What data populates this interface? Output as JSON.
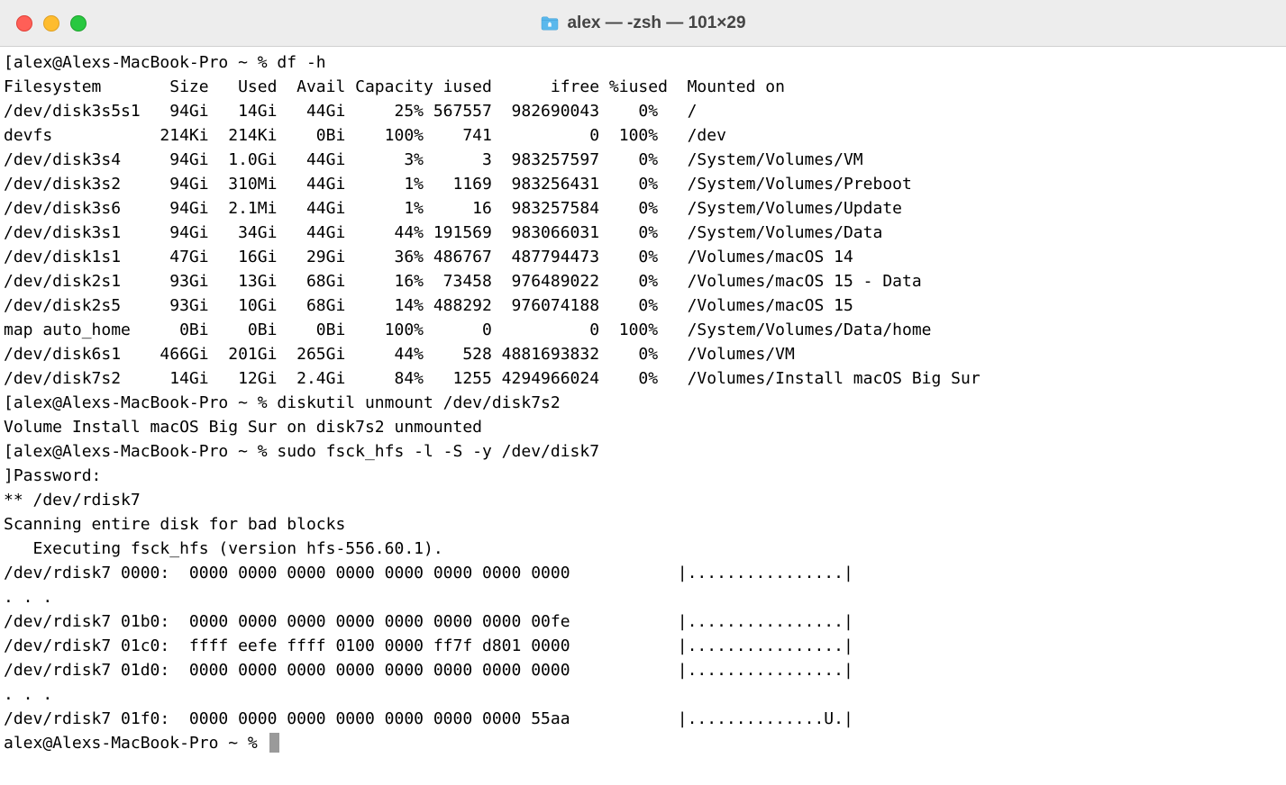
{
  "window": {
    "title": "alex — -zsh — 101×29"
  },
  "prompt_prefix": "[alex@Alexs-MacBook-Pro ~ % ",
  "commands": {
    "cmd1": "df -h",
    "cmd2": "diskutil unmount /dev/disk7s2",
    "cmd3": "sudo fsck_hfs -l -S -y /dev/disk7"
  },
  "df_header": {
    "fs": "Filesystem",
    "size": "Size",
    "used": "Used",
    "avail": "Avail",
    "capacity": "Capacity",
    "iused": "iused",
    "ifree": "ifree",
    "piused": "%iused",
    "mount": "Mounted on"
  },
  "df_rows": [
    {
      "fs": "/dev/disk3s5s1",
      "size": "94Gi",
      "used": "14Gi",
      "avail": "44Gi",
      "capacity": "25%",
      "iused": "567557",
      "ifree": "982690043",
      "piused": "0%",
      "mount": "/"
    },
    {
      "fs": "devfs",
      "size": "214Ki",
      "used": "214Ki",
      "avail": "0Bi",
      "capacity": "100%",
      "iused": "741",
      "ifree": "0",
      "piused": "100%",
      "mount": "/dev"
    },
    {
      "fs": "/dev/disk3s4",
      "size": "94Gi",
      "used": "1.0Gi",
      "avail": "44Gi",
      "capacity": "3%",
      "iused": "3",
      "ifree": "983257597",
      "piused": "0%",
      "mount": "/System/Volumes/VM"
    },
    {
      "fs": "/dev/disk3s2",
      "size": "94Gi",
      "used": "310Mi",
      "avail": "44Gi",
      "capacity": "1%",
      "iused": "1169",
      "ifree": "983256431",
      "piused": "0%",
      "mount": "/System/Volumes/Preboot"
    },
    {
      "fs": "/dev/disk3s6",
      "size": "94Gi",
      "used": "2.1Mi",
      "avail": "44Gi",
      "capacity": "1%",
      "iused": "16",
      "ifree": "983257584",
      "piused": "0%",
      "mount": "/System/Volumes/Update"
    },
    {
      "fs": "/dev/disk3s1",
      "size": "94Gi",
      "used": "34Gi",
      "avail": "44Gi",
      "capacity": "44%",
      "iused": "191569",
      "ifree": "983066031",
      "piused": "0%",
      "mount": "/System/Volumes/Data"
    },
    {
      "fs": "/dev/disk1s1",
      "size": "47Gi",
      "used": "16Gi",
      "avail": "29Gi",
      "capacity": "36%",
      "iused": "486767",
      "ifree": "487794473",
      "piused": "0%",
      "mount": "/Volumes/macOS 14"
    },
    {
      "fs": "/dev/disk2s1",
      "size": "93Gi",
      "used": "13Gi",
      "avail": "68Gi",
      "capacity": "16%",
      "iused": "73458",
      "ifree": "976489022",
      "piused": "0%",
      "mount": "/Volumes/macOS 15 - Data"
    },
    {
      "fs": "/dev/disk2s5",
      "size": "93Gi",
      "used": "10Gi",
      "avail": "68Gi",
      "capacity": "14%",
      "iused": "488292",
      "ifree": "976074188",
      "piused": "0%",
      "mount": "/Volumes/macOS 15"
    },
    {
      "fs": "map auto_home",
      "size": "0Bi",
      "used": "0Bi",
      "avail": "0Bi",
      "capacity": "100%",
      "iused": "0",
      "ifree": "0",
      "piused": "100%",
      "mount": "/System/Volumes/Data/home"
    },
    {
      "fs": "/dev/disk6s1",
      "size": "466Gi",
      "used": "201Gi",
      "avail": "265Gi",
      "capacity": "44%",
      "iused": "528",
      "ifree": "4881693832",
      "piused": "0%",
      "mount": "/Volumes/VM"
    },
    {
      "fs": "/dev/disk7s2",
      "size": "14Gi",
      "used": "12Gi",
      "avail": "2.4Gi",
      "capacity": "84%",
      "iused": "1255",
      "ifree": "4294966024",
      "piused": "0%",
      "mount": "/Volumes/Install macOS Big Sur"
    }
  ],
  "unmount_output": "Volume Install macOS Big Sur on disk7s2 unmounted",
  "fsck": {
    "password_line": "]Password:",
    "banner": "** /dev/rdisk7",
    "scan_line": "Scanning entire disk for bad blocks",
    "exec_line": "   Executing fsck_hfs (version hfs-556.60.1).",
    "hex_lines": [
      "/dev/rdisk7 0000:  0000 0000 0000 0000 0000 0000 0000 0000           |................|",
      ". . .",
      "/dev/rdisk7 01b0:  0000 0000 0000 0000 0000 0000 0000 00fe           |................|",
      "/dev/rdisk7 01c0:  ffff eefe ffff 0100 0000 ff7f d801 0000           |................|",
      "/dev/rdisk7 01d0:  0000 0000 0000 0000 0000 0000 0000 0000           |................|",
      ". . .",
      "/dev/rdisk7 01f0:  0000 0000 0000 0000 0000 0000 0000 55aa           |..............U.|"
    ]
  },
  "final_prompt": "alex@Alexs-MacBook-Pro ~ % "
}
